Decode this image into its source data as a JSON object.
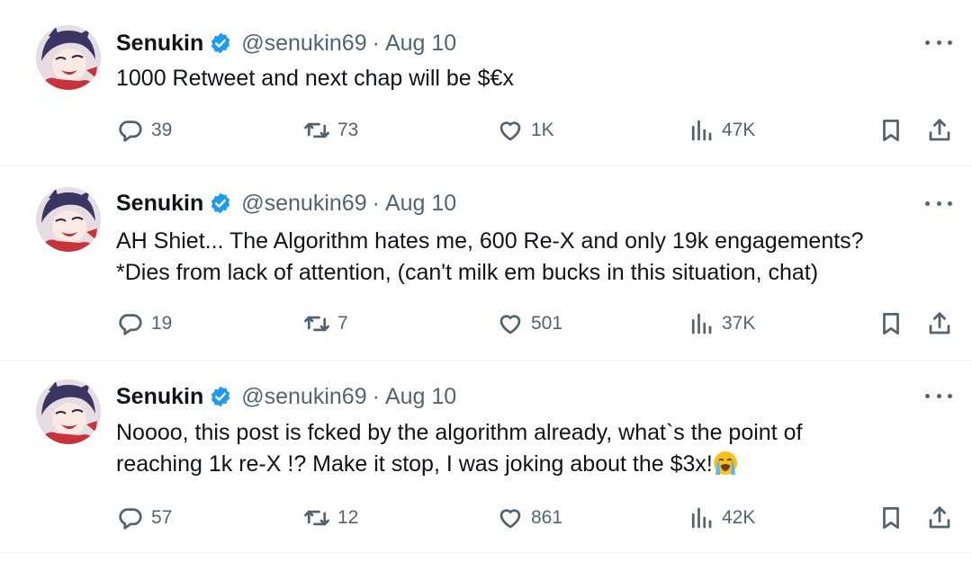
{
  "tweets": [
    {
      "name": "Senukin",
      "handle": "@senukin69",
      "separator": "·",
      "date": "Aug 10",
      "lines": [
        "1000 Retweet and next chap will be $€x"
      ],
      "replies": "39",
      "retweets": "73",
      "likes": "1K",
      "views": "47K"
    },
    {
      "name": "Senukin",
      "handle": "@senukin69",
      "separator": "·",
      "date": "Aug 10",
      "lines": [
        "AH Shiet... The Algorithm hates me, 600 Re-X and only 19k engagements?",
        "*Dies from lack of attention, (can't milk em bucks in this situation, chat)"
      ],
      "replies": "19",
      "retweets": "7",
      "likes": "501",
      "views": "37K"
    },
    {
      "name": "Senukin",
      "handle": "@senukin69",
      "separator": "·",
      "date": "Aug 10",
      "lines": [
        "Noooo, this post is fcked by the algorithm already, what`s the point of",
        "reaching 1k re-X !? Make it stop, I was joking about the $3x!"
      ],
      "emoji": "loudly-crying-face-emoji",
      "replies": "57",
      "retweets": "12",
      "likes": "861",
      "views": "42K"
    }
  ],
  "colors": {
    "verified": "#1d9bf0",
    "secondary_text": "#536471",
    "primary_text": "#0f1419",
    "divider": "#eff3f4"
  }
}
